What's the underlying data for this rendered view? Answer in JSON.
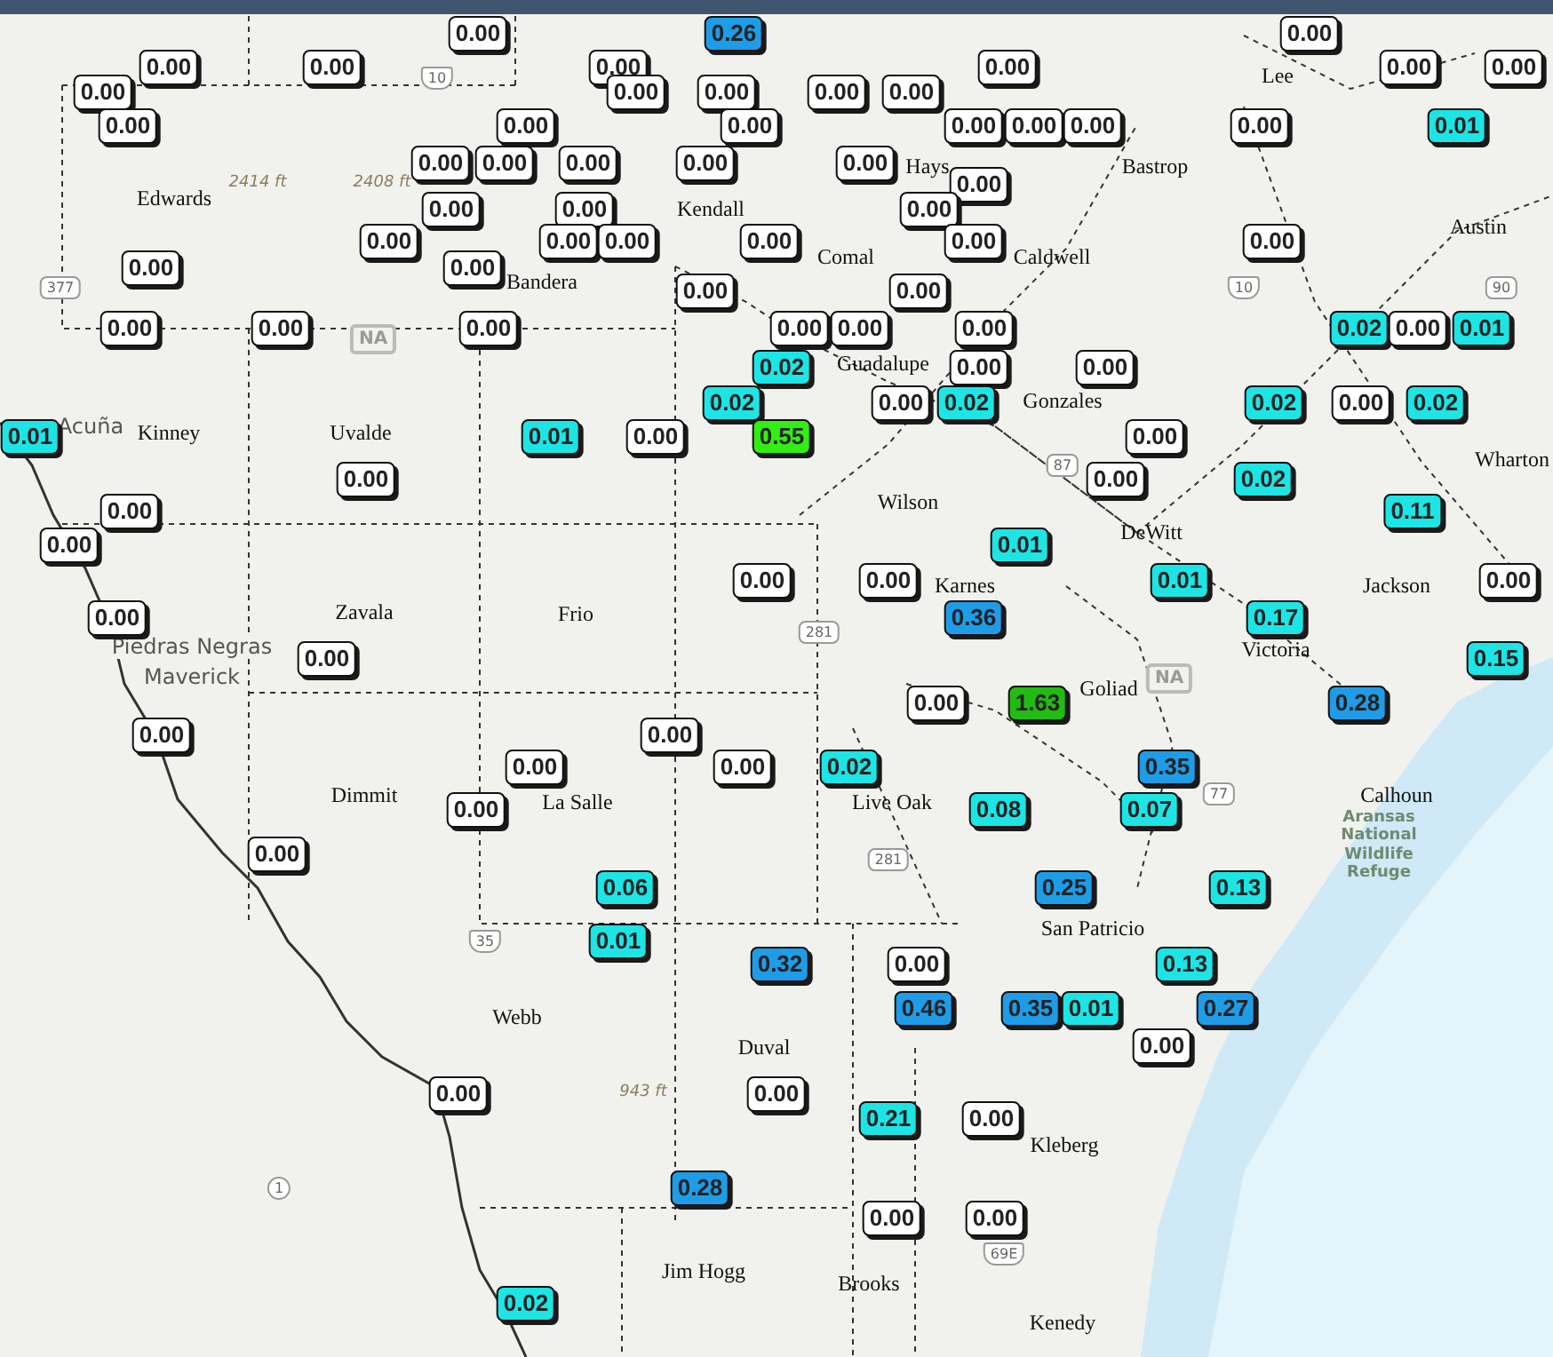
{
  "map": {
    "gauges": [
      {
        "value": "0.00",
        "color": "#ffffff"
      },
      {
        "value": "0.26",
        "color": "#1f9ce8"
      },
      {
        "value": "0.00",
        "color": "#ffffff"
      },
      {
        "value": "0.00",
        "color": "#ffffff"
      },
      {
        "value": "0.00",
        "color": "#ffffff"
      },
      {
        "value": "0.00",
        "color": "#ffffff"
      },
      {
        "value": "0.00",
        "color": "#ffffff"
      },
      {
        "value": "0.00",
        "color": "#ffffff"
      },
      {
        "value": "0.00",
        "color": "#ffffff"
      },
      {
        "value": "0.00",
        "color": "#ffffff"
      },
      {
        "value": "0.00",
        "color": "#ffffff"
      },
      {
        "value": "0.00",
        "color": "#ffffff"
      },
      {
        "value": "0.00",
        "color": "#ffffff"
      },
      {
        "value": "0.00",
        "color": "#ffffff"
      },
      {
        "value": "0.00",
        "color": "#ffffff"
      },
      {
        "value": "0.00",
        "color": "#ffffff"
      },
      {
        "value": "0.00",
        "color": "#ffffff"
      },
      {
        "value": "0.00",
        "color": "#ffffff"
      },
      {
        "value": "0.00",
        "color": "#ffffff"
      },
      {
        "value": "0.00",
        "color": "#ffffff"
      },
      {
        "value": "0.00",
        "color": "#ffffff"
      },
      {
        "value": "0.01",
        "color": "#1de5e5"
      },
      {
        "value": "0.00",
        "color": "#ffffff"
      },
      {
        "value": "0.00",
        "color": "#ffffff"
      },
      {
        "value": "0.00",
        "color": "#ffffff"
      },
      {
        "value": "0.00",
        "color": "#ffffff"
      },
      {
        "value": "0.00",
        "color": "#ffffff"
      },
      {
        "value": "0.00",
        "color": "#ffffff"
      },
      {
        "value": "0.00",
        "color": "#ffffff"
      },
      {
        "value": "0.00",
        "color": "#ffffff"
      },
      {
        "value": "0.00",
        "color": "#ffffff"
      },
      {
        "value": "0.00",
        "color": "#ffffff"
      },
      {
        "value": "0.00",
        "color": "#ffffff"
      },
      {
        "value": "0.00",
        "color": "#ffffff"
      },
      {
        "value": "0.00",
        "color": "#ffffff"
      },
      {
        "value": "0.00",
        "color": "#ffffff"
      },
      {
        "value": "0.00",
        "color": "#ffffff"
      },
      {
        "value": "0.00",
        "color": "#ffffff"
      },
      {
        "value": "0.00",
        "color": "#ffffff"
      },
      {
        "value": "0.00",
        "color": "#ffffff"
      },
      {
        "value": "0.00",
        "color": "#ffffff"
      },
      {
        "value": "0.00",
        "color": "#ffffff"
      },
      {
        "value": "0.00",
        "color": "#ffffff"
      },
      {
        "value": "0.00",
        "color": "#ffffff"
      },
      {
        "value": "0.00",
        "color": "#ffffff"
      },
      {
        "value": "0.00",
        "color": "#ffffff"
      },
      {
        "value": "0.00",
        "color": "#ffffff"
      },
      {
        "value": "0.02",
        "color": "#1de5e5"
      },
      {
        "value": "0.00",
        "color": "#ffffff"
      },
      {
        "value": "0.01",
        "color": "#1de5e5"
      },
      {
        "value": "0.02",
        "color": "#1de5e5"
      },
      {
        "value": "0.00",
        "color": "#ffffff"
      },
      {
        "value": "0.00",
        "color": "#ffffff"
      },
      {
        "value": "0.02",
        "color": "#1de5e5"
      },
      {
        "value": "0.00",
        "color": "#ffffff"
      },
      {
        "value": "0.02",
        "color": "#1de5e5"
      },
      {
        "value": "0.02",
        "color": "#1de5e5"
      },
      {
        "value": "0.00",
        "color": "#ffffff"
      },
      {
        "value": "0.02",
        "color": "#1de5e5"
      },
      {
        "value": "0.01",
        "color": "#1de5e5"
      },
      {
        "value": "0.01",
        "color": "#1de5e5"
      },
      {
        "value": "0.00",
        "color": "#ffffff"
      },
      {
        "value": "0.55",
        "color": "#33ee11"
      },
      {
        "value": "0.00",
        "color": "#ffffff"
      },
      {
        "value": "0.00",
        "color": "#ffffff"
      },
      {
        "value": "0.00",
        "color": "#ffffff"
      },
      {
        "value": "0.02",
        "color": "#1de5e5"
      },
      {
        "value": "0.00",
        "color": "#ffffff"
      },
      {
        "value": "0.11",
        "color": "#1de5e5"
      },
      {
        "value": "0.00",
        "color": "#ffffff"
      },
      {
        "value": "0.01",
        "color": "#1de5e5"
      },
      {
        "value": "0.00",
        "color": "#ffffff"
      },
      {
        "value": "0.00",
        "color": "#ffffff"
      },
      {
        "value": "0.01",
        "color": "#1de5e5"
      },
      {
        "value": "0.00",
        "color": "#ffffff"
      },
      {
        "value": "0.00",
        "color": "#ffffff"
      },
      {
        "value": "0.36",
        "color": "#1f9ce8"
      },
      {
        "value": "0.17",
        "color": "#1de5e5"
      },
      {
        "value": "0.00",
        "color": "#ffffff"
      },
      {
        "value": "0.15",
        "color": "#1de5e5"
      },
      {
        "value": "0.00",
        "color": "#ffffff"
      },
      {
        "value": "1.63",
        "color": "#22bb11"
      },
      {
        "value": "0.28",
        "color": "#1f9ce8"
      },
      {
        "value": "0.00",
        "color": "#ffffff"
      },
      {
        "value": "0.00",
        "color": "#ffffff"
      },
      {
        "value": "0.00",
        "color": "#ffffff"
      },
      {
        "value": "0.00",
        "color": "#ffffff"
      },
      {
        "value": "0.02",
        "color": "#1de5e5"
      },
      {
        "value": "0.35",
        "color": "#1f9ce8"
      },
      {
        "value": "0.00",
        "color": "#ffffff"
      },
      {
        "value": "0.08",
        "color": "#1de5e5"
      },
      {
        "value": "0.07",
        "color": "#1de5e5"
      },
      {
        "value": "0.00",
        "color": "#ffffff"
      },
      {
        "value": "0.06",
        "color": "#1de5e5"
      },
      {
        "value": "0.25",
        "color": "#1f9ce8"
      },
      {
        "value": "0.13",
        "color": "#1de5e5"
      },
      {
        "value": "0.01",
        "color": "#1de5e5"
      },
      {
        "value": "0.32",
        "color": "#1f9ce8"
      },
      {
        "value": "0.00",
        "color": "#ffffff"
      },
      {
        "value": "0.13",
        "color": "#1de5e5"
      },
      {
        "value": "0.46",
        "color": "#1f9ce8"
      },
      {
        "value": "0.35",
        "color": "#1f9ce8"
      },
      {
        "value": "0.01",
        "color": "#1de5e5"
      },
      {
        "value": "0.27",
        "color": "#1f9ce8"
      },
      {
        "value": "0.00",
        "color": "#ffffff"
      },
      {
        "value": "0.00",
        "color": "#ffffff"
      },
      {
        "value": "0.00",
        "color": "#ffffff"
      },
      {
        "value": "0.21",
        "color": "#1de5e5"
      },
      {
        "value": "0.00",
        "color": "#ffffff"
      },
      {
        "value": "0.28",
        "color": "#1f9ce8"
      },
      {
        "value": "0.00",
        "color": "#ffffff"
      },
      {
        "value": "0.00",
        "color": "#ffffff"
      },
      {
        "value": "0.02",
        "color": "#1de5e5"
      }
    ],
    "county_labels": [
      "Lee",
      "Hays",
      "Bastrop",
      "Edwards",
      "Kendall",
      "Austin",
      "Comal",
      "Caldwell",
      "Bandera",
      "Guadalupe",
      "Gonzales",
      "Kinney",
      "Uvalde",
      "Wharton",
      "Wilson",
      "DeWitt",
      "Karnes",
      "Jackson",
      "Zavala",
      "Frio",
      "Victoria",
      "Goliad",
      "Dimmit",
      "La Salle",
      "Live Oak",
      "Calhoun",
      "San Patricio",
      "Webb",
      "Duval",
      "Kleberg",
      "Jim Hogg",
      "Brooks",
      "Kenedy"
    ],
    "place_labels": [
      "Acuña",
      "Piedras Negras",
      "Maverick"
    ],
    "park_labels": [
      "Aransas National Wildlife Refuge"
    ],
    "elevation_labels": [
      "2414 ft",
      "2408 ft",
      "943 ft"
    ],
    "highway_shields": [
      {
        "text": "10",
        "kind": "interstate"
      },
      {
        "text": "377",
        "kind": "us"
      },
      {
        "text": "10",
        "kind": "interstate"
      },
      {
        "text": "90",
        "kind": "us"
      },
      {
        "text": "NA",
        "kind": "na"
      },
      {
        "text": "87",
        "kind": "us"
      },
      {
        "text": "281",
        "kind": "us"
      },
      {
        "text": "NA",
        "kind": "na"
      },
      {
        "text": "77",
        "kind": "us"
      },
      {
        "text": "281",
        "kind": "us"
      },
      {
        "text": "35",
        "kind": "interstate"
      },
      {
        "text": "1",
        "kind": "state"
      },
      {
        "text": "69E",
        "kind": "interstate"
      }
    ]
  }
}
